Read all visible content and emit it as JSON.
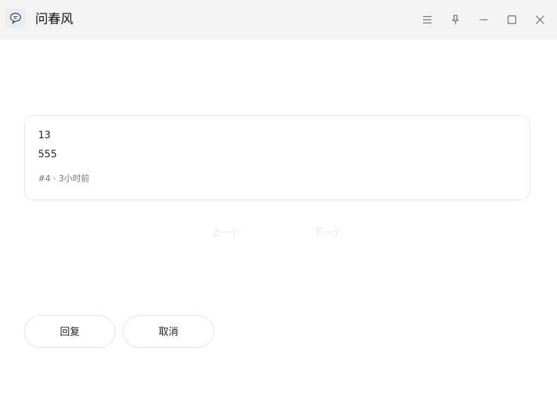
{
  "app": {
    "title": "问春风",
    "icon": "chat-bubble-icon"
  },
  "window_controls": {
    "menu": "menu-icon",
    "pin": "pin-icon",
    "minimize": "minimize-icon",
    "maximize": "maximize-icon",
    "close": "close-icon"
  },
  "message": {
    "line1": "13",
    "line2": "555",
    "meta": "#4 · 3小时前"
  },
  "navigation": {
    "prev_label": "上一个",
    "next_label": "下一个"
  },
  "actions": {
    "reply_label": "回复",
    "cancel_label": "取消"
  },
  "colors": {
    "titlebar_bg": "#f3f3f3",
    "card_border": "#e6e6e6",
    "disabled_text": "#e6e6e6"
  }
}
